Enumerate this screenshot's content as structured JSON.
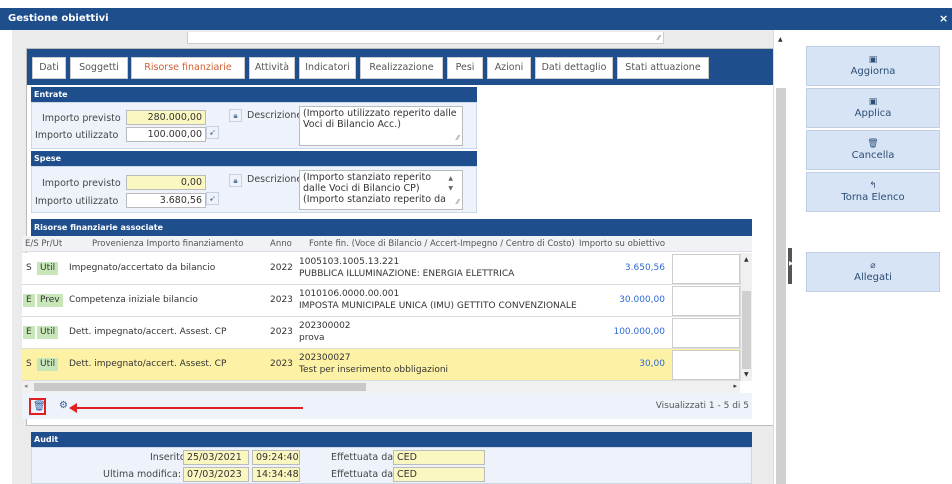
{
  "window": {
    "title": "Gestione obiettivi",
    "close": "×"
  },
  "tabs": [
    {
      "label": "Dati"
    },
    {
      "label": "Soggetti"
    },
    {
      "label": "Risorse finanziarie",
      "active": true
    },
    {
      "label": "Attività"
    },
    {
      "label": "Indicatori"
    },
    {
      "label": "Realizzazione"
    },
    {
      "label": "Pesi"
    },
    {
      "label": "Azioni"
    },
    {
      "label": "Dati dettaglio"
    },
    {
      "label": "Stati attuazione"
    }
  ],
  "entrate": {
    "header": "Entrate",
    "importo_previsto_label": "Importo previsto",
    "importo_previsto": "280.000,00",
    "importo_utilizzato_label": "Importo utilizzato",
    "importo_utilizzato": "100.000,00",
    "descrizione_label": "Descrizione",
    "descrizione": "(Importo utilizzato reperito dalle Voci di Bilancio Acc.)"
  },
  "spese": {
    "header": "Spese",
    "importo_previsto_label": "Importo previsto",
    "importo_previsto": "0,00",
    "importo_utilizzato_label": "Importo utilizzato",
    "importo_utilizzato": "3.680,56",
    "descrizione_label": "Descrizione",
    "descrizione_1": "(Importo stanziato reperito",
    "descrizione_2": "dalle Voci di Bilancio CP)",
    "descrizione_3": "(Importo stanziato reperito da"
  },
  "grid": {
    "header": "Risorse finanziarie associate",
    "columns": {
      "es_prut": "E/S  Pr/Ut",
      "provenienza": "Provenienza Importo finanziamento",
      "anno": "Anno",
      "fonte": "Fonte fin. (Voce di Bilancio / Accert-Impegno / Centro di Costo)",
      "importo": "Importo su obiettivo"
    },
    "rows": [
      {
        "es": "S",
        "prut": "Util",
        "provenienza": "Impegnato/accertato da bilancio",
        "anno": "2022",
        "fonte1": "1005103.1005.13.221",
        "fonte2": "PUBBLICA ILLUMINAZIONE: ENERGIA ELETTRICA",
        "importo": "3.650,56"
      },
      {
        "es": "E",
        "prut": "Prev",
        "provenienza": "Competenza iniziale bilancio",
        "anno": "2023",
        "fonte1": "1010106.0000.00.001",
        "fonte2": "IMPOSTA MUNICIPALE UNICA (IMU) GETTITO CONVENZIONALE",
        "importo": "30.000,00"
      },
      {
        "es": "E",
        "prut": "Util",
        "provenienza": "Dett. impegnato/accert. Assest. CP",
        "anno": "2023",
        "fonte1": "202300002",
        "fonte2": "prova",
        "importo": "100.000,00"
      },
      {
        "es": "S",
        "prut": "Util",
        "provenienza": "Dett. impegnato/accert. Assest. CP",
        "anno": "2023",
        "fonte1": "202300027",
        "fonte2": "Test per inserimento obbligazioni",
        "importo": "30,00"
      }
    ],
    "footer_status": "Visualizzati 1 - 5 di 5"
  },
  "audit": {
    "header": "Audit",
    "inserito_label": "Inserito il:",
    "inserito_date": "25/03/2021",
    "inserito_time": "09:24:40",
    "effettuata_label": "Effettuata da:",
    "inserito_by": "CED",
    "modifica_label": "Ultima modifica:",
    "modifica_date": "07/03/2023",
    "modifica_time": "14:34:48",
    "modifica_by": "CED"
  },
  "sidebar": [
    {
      "label": "Aggiorna",
      "icon": "save-icon"
    },
    {
      "label": "Applica",
      "icon": "save-icon"
    },
    {
      "label": "Cancella",
      "icon": "trash-icon"
    },
    {
      "label": "Torna Elenco",
      "icon": "back-icon"
    },
    {
      "label": "Allegati",
      "icon": "paperclip-icon"
    }
  ],
  "colors": {
    "header_blue": "#1f4e8c",
    "accent_tab": "#d15f33",
    "highlight_row": "#fdf1a6",
    "badge_green": "#c8e7b8",
    "annotation_red": "#e02020"
  }
}
